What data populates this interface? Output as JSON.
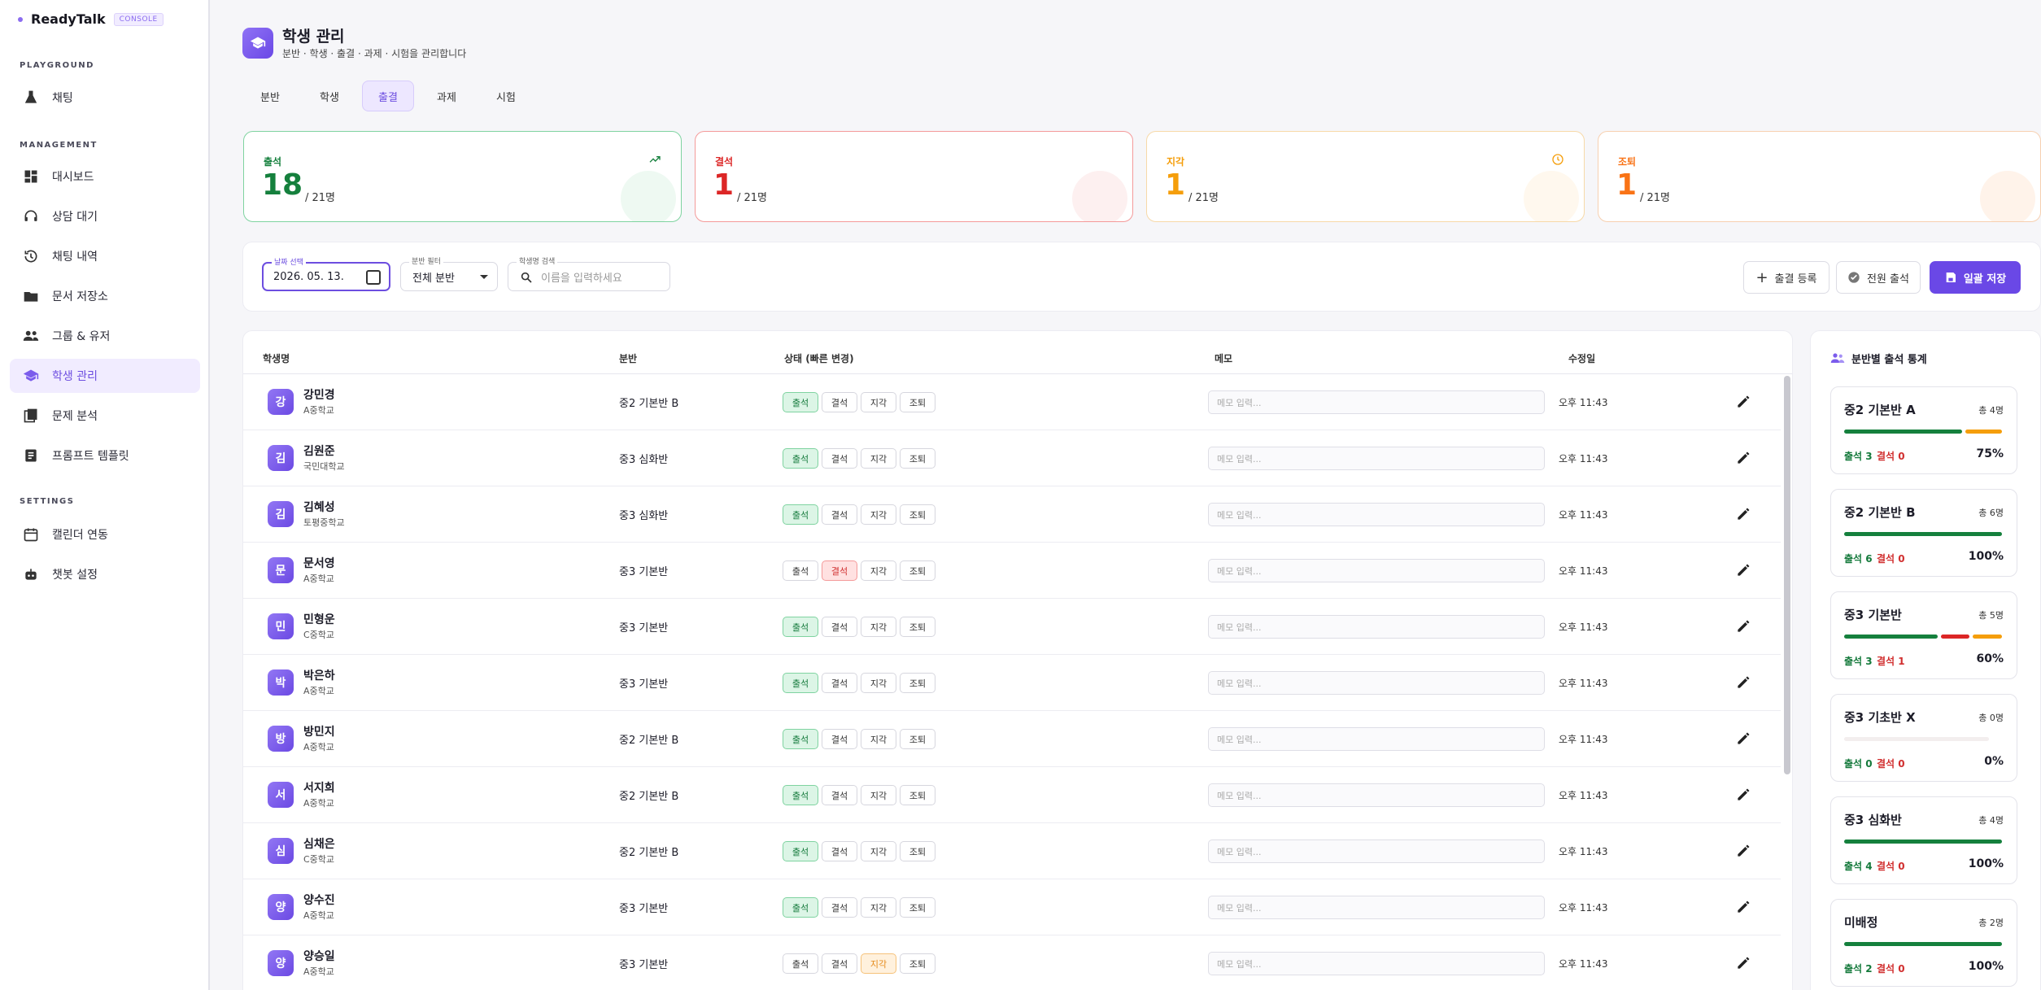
{
  "brand": {
    "name": "ReadyTalk",
    "badge": "CONSOLE"
  },
  "sidebar": {
    "sections": [
      "PLAYGROUND",
      "MANAGEMENT",
      "SETTINGS"
    ],
    "items": [
      {
        "label": "채팅",
        "icon": "flask-icon"
      },
      {
        "label": "대시보드",
        "icon": "dashboard-icon"
      },
      {
        "label": "상담 대기",
        "icon": "headset-icon"
      },
      {
        "label": "채팅 내역",
        "icon": "history-icon"
      },
      {
        "label": "문서 저장소",
        "icon": "folder-icon"
      },
      {
        "label": "그룹 & 유저",
        "icon": "users-icon"
      },
      {
        "label": "학생 관리",
        "icon": "school-icon"
      },
      {
        "label": "문제 분석",
        "icon": "quiz-icon"
      },
      {
        "label": "프롬프트 템플릿",
        "icon": "template-icon"
      },
      {
        "label": "캘린더 연동",
        "icon": "calendar-icon"
      },
      {
        "label": "챗봇 설정",
        "icon": "robot-icon"
      }
    ]
  },
  "page": {
    "title": "학생 관리",
    "subtitle": "분반 · 학생 · 출결 · 과제 · 시험을 관리합니다"
  },
  "tabs": [
    "분반",
    "학생",
    "출결",
    "과제",
    "시험"
  ],
  "summary": [
    {
      "label": "출석",
      "count": "18",
      "total": "/ 21명",
      "color": "#15803d"
    },
    {
      "label": "결석",
      "count": "1",
      "total": "/ 21명",
      "color": "#dc2626"
    },
    {
      "label": "지각",
      "count": "1",
      "total": "/ 21명",
      "color": "#f59e0b"
    },
    {
      "label": "조퇴",
      "count": "1",
      "total": "/ 21명",
      "color": "#f97316"
    }
  ],
  "filters": {
    "date_label": "날짜 선택",
    "date_value": "2026. 05. 13.",
    "class_label": "분반 필터",
    "class_value": "전체 분반",
    "search_label": "학생명 검색",
    "search_placeholder": "이름을 입력하세요"
  },
  "actions": {
    "add": "출결 등록",
    "all_present": "전원 출석",
    "save": "일괄 저장"
  },
  "table": {
    "headers": [
      "학생명",
      "분반",
      "상태 (빠른 변경)",
      "메모",
      "수정일"
    ],
    "status_labels": [
      "출석",
      "결석",
      "지각",
      "조퇴"
    ],
    "memo_placeholder": "메모 입력...",
    "rows": [
      {
        "initial": "강",
        "name": "강민경",
        "school": "A중학교",
        "class": "중2 기본반 B",
        "status": 0,
        "time": "오후 11:43"
      },
      {
        "initial": "김",
        "name": "김원준",
        "school": "국민대학교",
        "class": "중3 심화반",
        "status": 0,
        "time": "오후 11:43"
      },
      {
        "initial": "김",
        "name": "김혜성",
        "school": "토평중학교",
        "class": "중3 심화반",
        "status": 0,
        "time": "오후 11:43"
      },
      {
        "initial": "문",
        "name": "문서영",
        "school": "A중학교",
        "class": "중3 기본반",
        "status": 1,
        "time": "오후 11:43"
      },
      {
        "initial": "민",
        "name": "민형운",
        "school": "C중학교",
        "class": "중3 기본반",
        "status": 0,
        "time": "오후 11:43"
      },
      {
        "initial": "박",
        "name": "박은하",
        "school": "A중학교",
        "class": "중3 기본반",
        "status": 0,
        "time": "오후 11:43"
      },
      {
        "initial": "방",
        "name": "방민지",
        "school": "A중학교",
        "class": "중2 기본반 B",
        "status": 0,
        "time": "오후 11:43"
      },
      {
        "initial": "서",
        "name": "서지희",
        "school": "A중학교",
        "class": "중2 기본반 B",
        "status": 0,
        "time": "오후 11:43"
      },
      {
        "initial": "심",
        "name": "심채은",
        "school": "C중학교",
        "class": "중2 기본반 B",
        "status": 0,
        "time": "오후 11:43"
      },
      {
        "initial": "양",
        "name": "양수진",
        "school": "A중학교",
        "class": "중3 기본반",
        "status": 0,
        "time": "오후 11:43"
      },
      {
        "initial": "양",
        "name": "양승일",
        "school": "A중학교",
        "class": "중3 기본반",
        "status": 2,
        "time": "오후 11:43"
      }
    ]
  },
  "stats": {
    "title": "분반별 출석 통계",
    "classes": [
      {
        "name": "중2 기본반 A",
        "total": "총 4명",
        "present": "출석 3",
        "absent": "결석 0",
        "pct": "75%",
        "p": 3,
        "a": 0,
        "l": 1,
        "n": 4
      },
      {
        "name": "중2 기본반 B",
        "total": "총 6명",
        "present": "출석 6",
        "absent": "결석 0",
        "pct": "100%",
        "p": 6,
        "a": 0,
        "l": 0,
        "n": 6
      },
      {
        "name": "중3 기본반",
        "total": "총 5명",
        "present": "출석 3",
        "absent": "결석 1",
        "pct": "60%",
        "p": 3,
        "a": 1,
        "l": 1,
        "n": 5
      },
      {
        "name": "중3 기초반 X",
        "total": "총 0명",
        "present": "출석 0",
        "absent": "결석 0",
        "pct": "0%",
        "p": 0,
        "a": 0,
        "l": 0,
        "n": 0
      },
      {
        "name": "중3 심화반",
        "total": "총 4명",
        "present": "출석 4",
        "absent": "결석 0",
        "pct": "100%",
        "p": 4,
        "a": 0,
        "l": 0,
        "n": 4
      },
      {
        "name": "미배정",
        "total": "총 2명",
        "present": "출석 2",
        "absent": "결석 0",
        "pct": "100%",
        "p": 2,
        "a": 0,
        "l": 0,
        "n": 2
      }
    ]
  }
}
